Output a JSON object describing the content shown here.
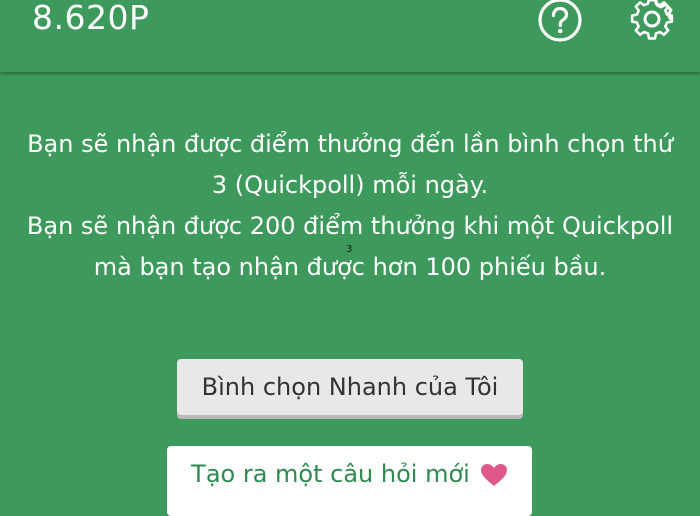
{
  "header": {
    "points": "8.620P",
    "help_icon": "help-circle-icon",
    "settings_icon": "gear-icon"
  },
  "info": {
    "line1": "Bạn sẽ nhận được điểm thưởng đến lần bình chọn thứ 3 (Quickpoll) mỗi ngày.",
    "line2": "Bạn sẽ nhận được 200 điểm thưởng khi một Quickpoll mà bạn tạo nhận được hơn 100 phiếu bầu.",
    "marker": "3"
  },
  "buttons": {
    "my_quickpolls": "Bình chọn Nhanh của Tôi",
    "create_question": "Tạo ra một câu hỏi mới",
    "create_icon": "heart-icon"
  },
  "colors": {
    "background": "#3d9a5c",
    "heart": "#e0578a",
    "accent_text": "#2f8a50"
  }
}
